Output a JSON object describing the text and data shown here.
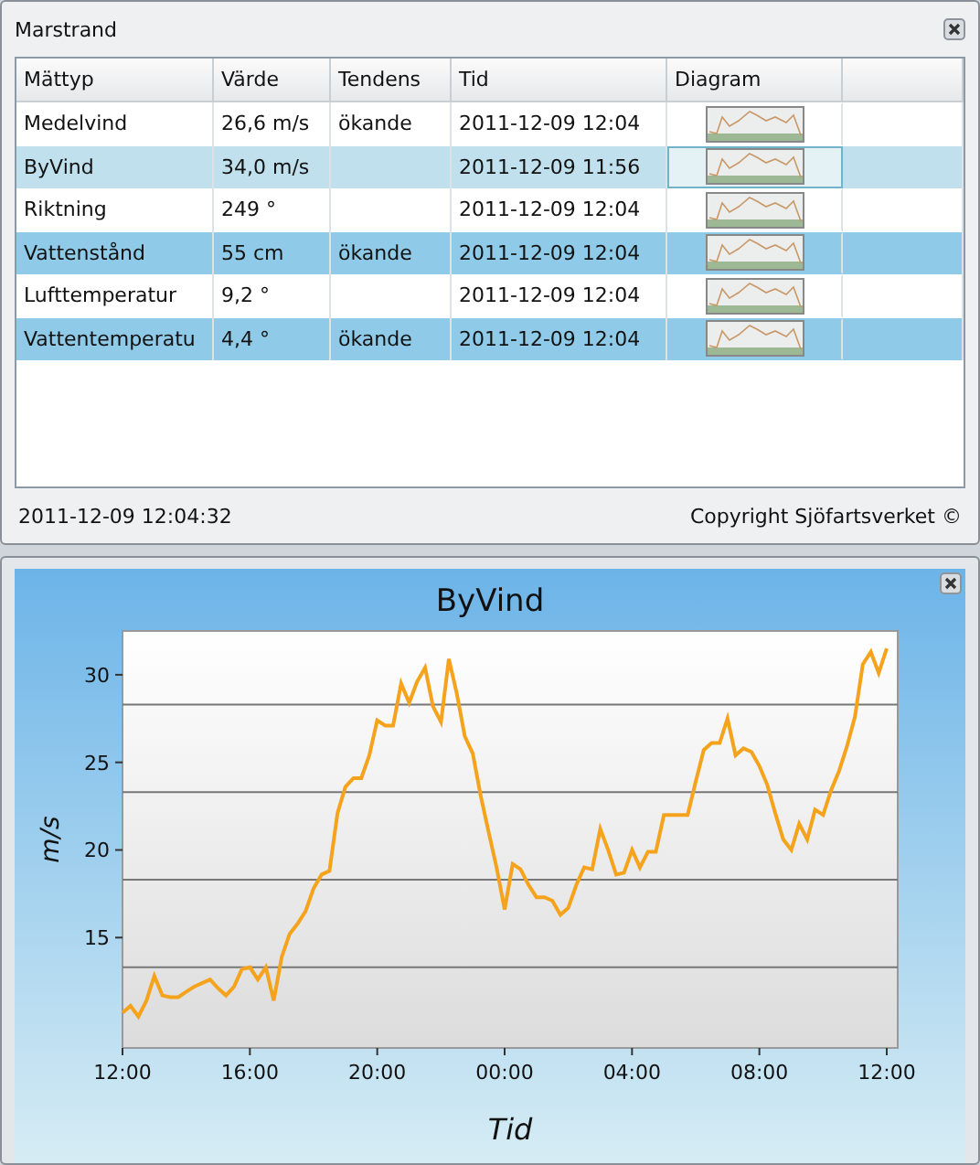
{
  "window": {
    "title": "Marstrand"
  },
  "table": {
    "columns": [
      "Mättyp",
      "Värde",
      "Tendens",
      "Tid",
      "Diagram"
    ],
    "rows": [
      {
        "type": "Medelvind",
        "value": "26,6 m/s",
        "trend": "ökande",
        "time": "2011-12-09 12:04",
        "selected": false
      },
      {
        "type": "ByVind",
        "value": "34,0 m/s",
        "trend": "",
        "time": "2011-12-09 11:56",
        "selected": true
      },
      {
        "type": "Riktning",
        "value": "249 °",
        "trend": "",
        "time": "2011-12-09 12:04",
        "selected": false
      },
      {
        "type": "Vattenstånd",
        "value": "55 cm",
        "trend": "ökande",
        "time": "2011-12-09 12:04",
        "selected": false
      },
      {
        "type": "Lufttemperatur",
        "value": "9,2 °",
        "trend": "",
        "time": "2011-12-09 12:04",
        "selected": false
      },
      {
        "type": "Vattentemperatu",
        "value": "4,4 °",
        "trend": "ökande",
        "time": "2011-12-09 12:04",
        "selected": false
      }
    ]
  },
  "status_bar": {
    "timestamp": "2011-12-09 12:04:32",
    "copyright": "Copyright Sjöfartsverket ©"
  },
  "chart_panel": {
    "chart_data": {
      "type": "line",
      "title": "ByVind",
      "xlabel": "Tid",
      "ylabel": "m/s",
      "ylim": [
        8.7,
        32.5
      ],
      "yticks": [
        15,
        20,
        25,
        30
      ],
      "categories": [
        "12:00",
        null,
        null,
        null,
        null,
        null,
        null,
        null,
        null,
        null,
        null,
        null,
        null,
        null,
        null,
        null,
        "16:00",
        null,
        null,
        null,
        null,
        null,
        null,
        null,
        null,
        null,
        null,
        null,
        null,
        null,
        null,
        null,
        "20:00",
        null,
        null,
        null,
        null,
        null,
        null,
        null,
        null,
        null,
        null,
        null,
        null,
        null,
        null,
        null,
        "00:00",
        null,
        null,
        null,
        null,
        null,
        null,
        null,
        null,
        null,
        null,
        null,
        null,
        null,
        null,
        null,
        "04:00",
        null,
        null,
        null,
        null,
        null,
        null,
        null,
        null,
        null,
        null,
        null,
        null,
        null,
        null,
        null,
        "08:00",
        null,
        null,
        null,
        null,
        null,
        null,
        null,
        null,
        null,
        null,
        null,
        null,
        null,
        null,
        null,
        "12:00"
      ],
      "series": [
        {
          "color": "#f5a31c",
          "values": [
            10.7,
            11.1,
            10.5,
            11.4,
            12.8,
            11.7,
            11.6,
            11.6,
            11.9,
            12.2,
            12.4,
            12.6,
            12.1,
            11.7,
            12.2,
            13.2,
            13.3,
            12.6,
            13.3,
            11.4,
            13.9,
            15.2,
            15.8,
            16.5,
            17.8,
            18.6,
            18.8,
            22.1,
            23.6,
            24.1,
            24.1,
            25.4,
            27.4,
            27.1,
            27.1,
            29.5,
            28.4,
            29.6,
            30.4,
            28.2,
            27.3,
            30.9,
            28.9,
            26.5,
            25.5,
            23.1,
            21.0,
            19.0,
            16.6,
            19.2,
            18.9,
            18.0,
            17.3,
            17.3,
            17.1,
            16.3,
            16.7,
            18.0,
            19.0,
            18.9,
            21.2,
            20.0,
            18.6,
            18.7,
            20.0,
            19.0,
            19.9,
            19.9,
            22.0,
            22.0,
            22.0,
            22.0,
            23.9,
            25.7,
            26.1,
            26.1,
            27.5,
            25.4,
            25.8,
            25.6,
            24.8,
            23.7,
            22.1,
            20.6,
            20.0,
            21.5,
            20.6,
            22.3,
            22.0,
            23.4,
            24.5,
            25.9,
            27.6,
            30.6,
            31.3,
            30.1,
            31.5
          ]
        }
      ]
    }
  }
}
